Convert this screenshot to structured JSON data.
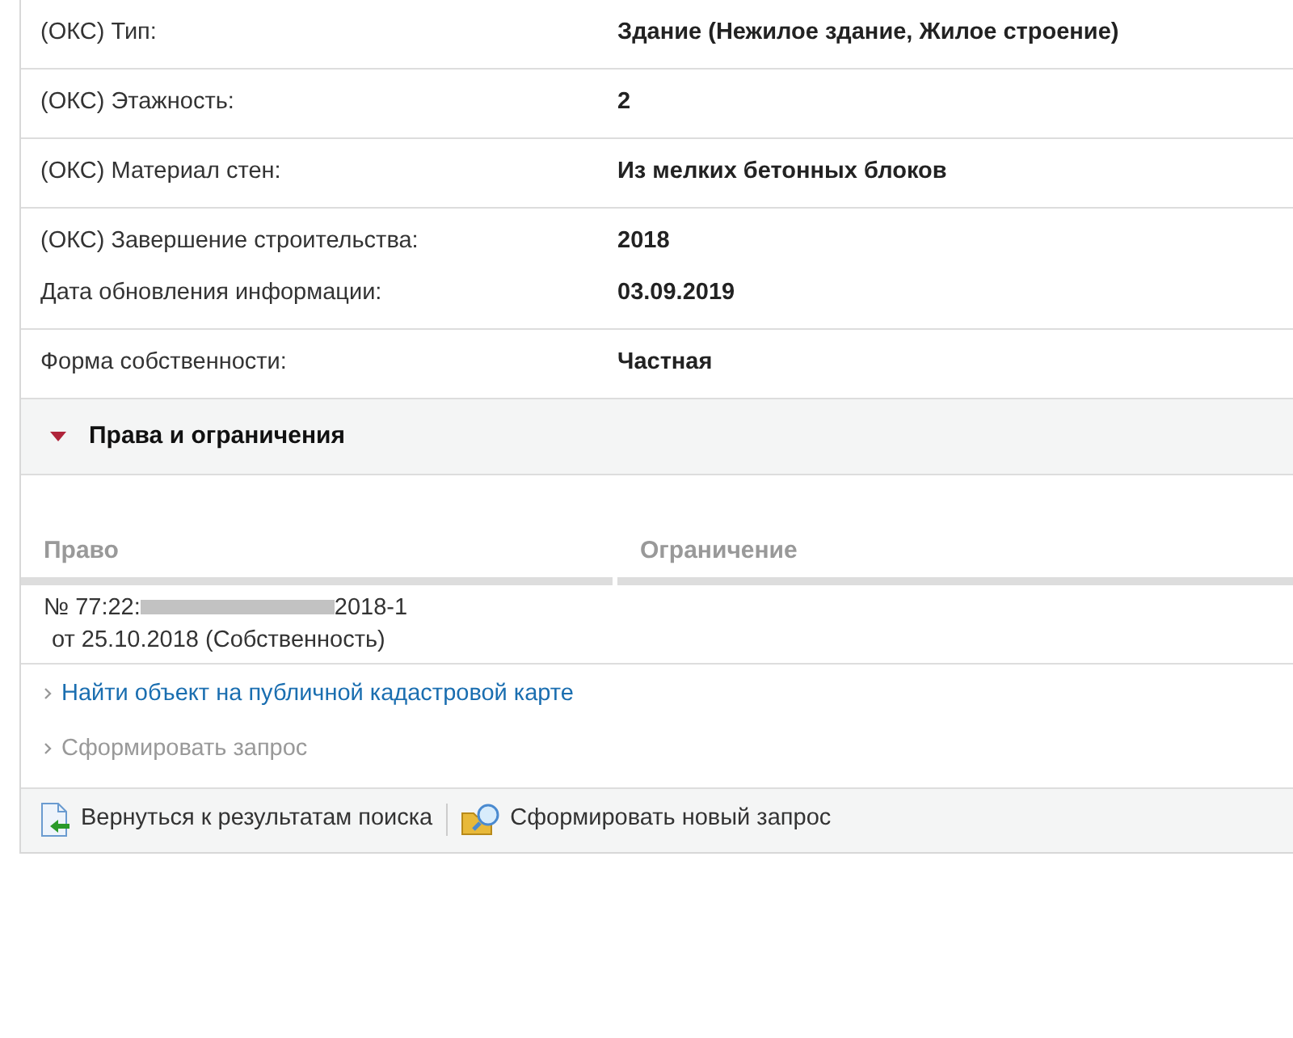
{
  "properties": [
    {
      "rows": [
        {
          "label": "(ОКС) Тип:",
          "value": "Здание (Нежилое здание, Жилое строение)"
        }
      ]
    },
    {
      "rows": [
        {
          "label": "(ОКС) Этажность:",
          "value": "2"
        }
      ]
    },
    {
      "rows": [
        {
          "label": "(ОКС) Материал стен:",
          "value": "Из мелких бетонных блоков"
        }
      ]
    },
    {
      "rows": [
        {
          "label": "(ОКС) Завершение строительства:",
          "value": "2018"
        },
        {
          "label": "Дата обновления информации:",
          "value": "03.09.2019"
        }
      ]
    },
    {
      "rows": [
        {
          "label": "Форма собственности:",
          "value": "Частная"
        }
      ]
    }
  ],
  "section": {
    "title": "Права и ограничения",
    "expanded": true
  },
  "rights_table": {
    "columns": [
      "Право",
      "Ограничение"
    ],
    "rows": [
      {
        "number_start": "№ 77:22:",
        "number_end": "2018-1",
        "date_line": "от 25.10.2018  (Собственность)"
      }
    ]
  },
  "links": [
    {
      "label": "Найти объект на публичной кадастровой карте",
      "disabled": false
    },
    {
      "label": "Сформировать запрос",
      "disabled": true
    }
  ],
  "toolbar": [
    {
      "kind": "back",
      "label": "Вернуться к результатам поиска"
    },
    {
      "kind": "new-request",
      "label": "Сформировать новый запрос"
    }
  ]
}
